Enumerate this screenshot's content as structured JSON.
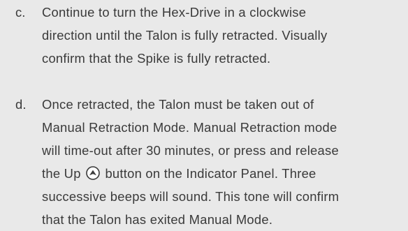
{
  "steps": [
    {
      "letter": "c.",
      "lines": [
        "Continue to turn the Hex-Drive in a clockwise",
        "direction until the Talon is fully retracted.  Visually",
        "confirm that the Spike is fully retracted."
      ]
    },
    {
      "letter": "d.",
      "lines": [
        "Once retracted, the Talon must be taken out of",
        "Manual Retraction Mode. Manual Retraction mode",
        "will time-out after 30 minutes, or press and release",
        "the Up",
        "button on the Indicator Panel. Three",
        "successive beeps will sound. This tone will confirm",
        "that the Talon has exited Manual Mode."
      ]
    }
  ],
  "icons": {
    "up_button": "up-arrow-circle-icon"
  },
  "colors": {
    "background": "#e9e9e9",
    "text": "#3a3a3a"
  }
}
